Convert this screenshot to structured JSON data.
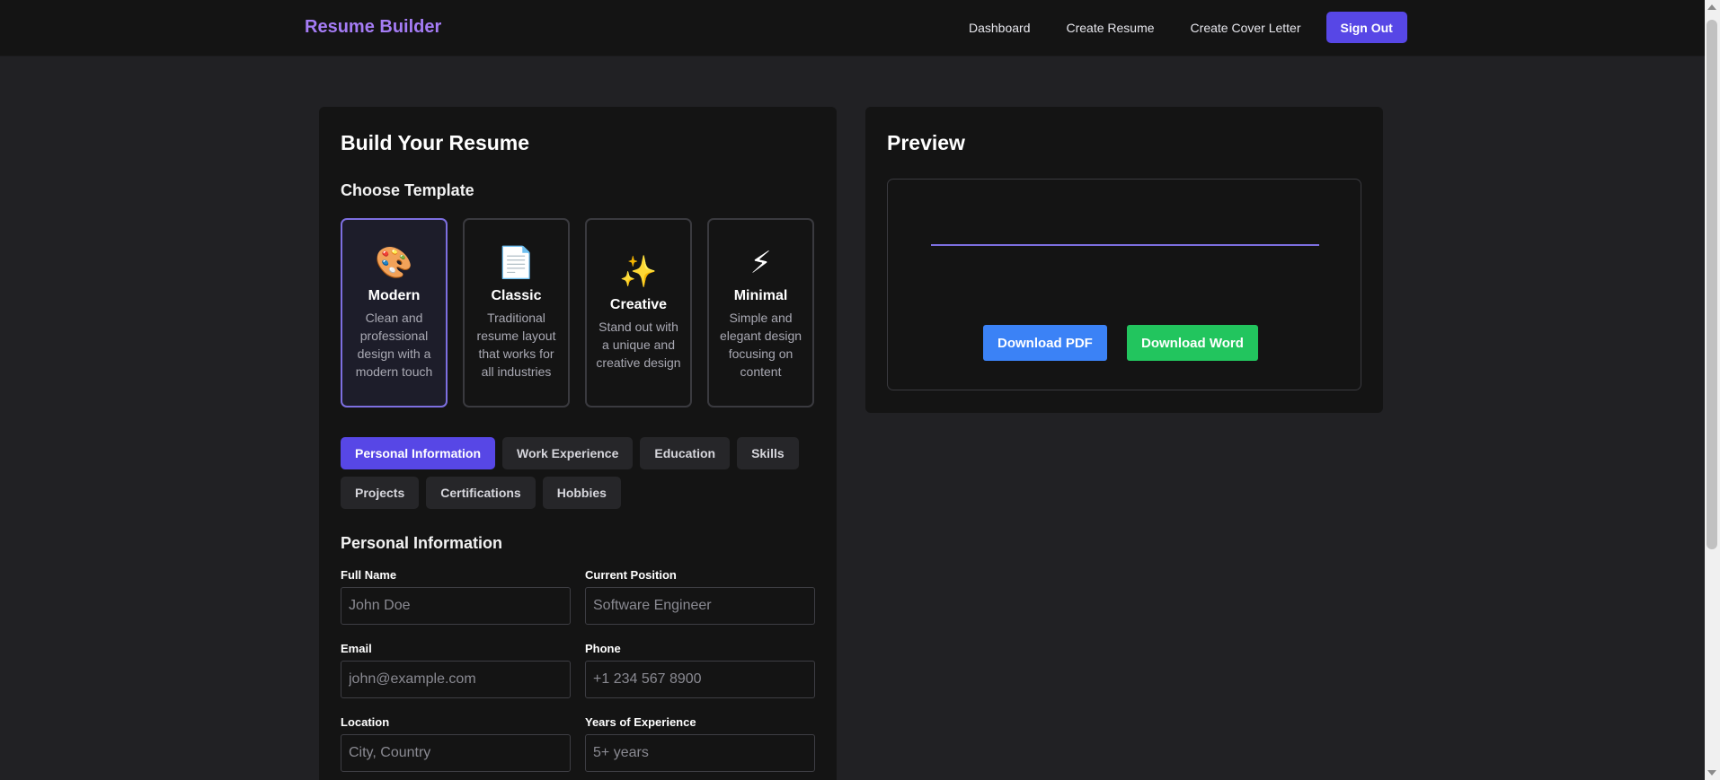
{
  "nav": {
    "brand": "Resume Builder",
    "links": [
      "Dashboard",
      "Create Resume",
      "Create Cover Letter"
    ],
    "signout": "Sign Out"
  },
  "builder": {
    "title": "Build Your Resume",
    "template_heading": "Choose Template",
    "templates": [
      {
        "icon": "🎨",
        "icon_name": "palette-icon",
        "name": "Modern",
        "desc": "Clean and professional design with a modern touch",
        "selected": true
      },
      {
        "icon": "📄",
        "icon_name": "document-icon",
        "name": "Classic",
        "desc": "Traditional resume layout that works for all industries",
        "selected": false
      },
      {
        "icon": "✨",
        "icon_name": "sparkles-icon",
        "name": "Creative",
        "desc": "Stand out with a unique and creative design",
        "selected": false
      },
      {
        "icon": "⚡",
        "icon_name": "lightning-icon",
        "name": "Minimal",
        "desc": "Simple and elegant design focusing on content",
        "selected": false
      }
    ],
    "tabs": [
      "Personal Information",
      "Work Experience",
      "Education",
      "Skills",
      "Projects",
      "Certifications",
      "Hobbies"
    ],
    "active_tab": "Personal Information",
    "form_heading": "Personal Information",
    "fields": {
      "full_name": {
        "label": "Full Name",
        "placeholder": "John Doe",
        "value": ""
      },
      "current_position": {
        "label": "Current Position",
        "placeholder": "Software Engineer",
        "value": ""
      },
      "email": {
        "label": "Email",
        "placeholder": "john@example.com",
        "value": ""
      },
      "phone": {
        "label": "Phone",
        "placeholder": "+1 234 567 8900",
        "value": ""
      },
      "location": {
        "label": "Location",
        "placeholder": "City, Country",
        "value": ""
      },
      "years_experience": {
        "label": "Years of Experience",
        "placeholder": "5+ years",
        "value": ""
      }
    }
  },
  "preview": {
    "title": "Preview",
    "download_pdf": "Download PDF",
    "download_word": "Download Word"
  },
  "colors": {
    "accent": "#5747e6",
    "brand": "#a57cf5",
    "pdf_button": "#3b82f6",
    "word_button": "#22c55e"
  }
}
